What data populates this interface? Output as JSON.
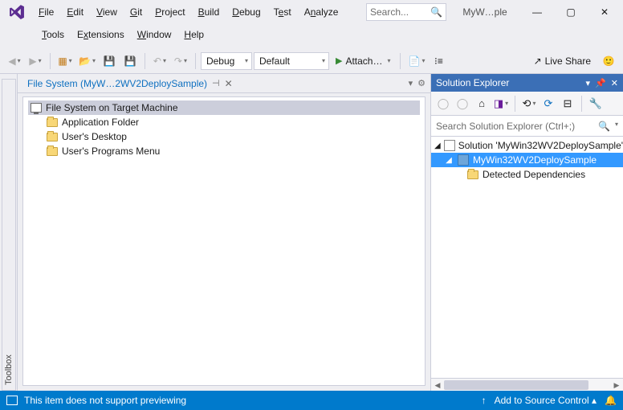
{
  "menu": {
    "file": "File",
    "edit": "Edit",
    "view": "View",
    "git": "Git",
    "project": "Project",
    "build": "Build",
    "debug": "Debug",
    "test": "Test",
    "analyze": "Analyze",
    "tools": "Tools",
    "extensions": "Extensions",
    "window": "Window",
    "help": "Help"
  },
  "search": {
    "placeholder": "Search..."
  },
  "solution_short": "MyW…ple",
  "toolbar": {
    "config": "Debug",
    "platform": "Default",
    "attach": "Attach…",
    "liveshare": "Live Share"
  },
  "sidebar": {
    "toolbox": "Toolbox"
  },
  "doc_tab": {
    "title": "File System (MyW…2WV2DeploySample)"
  },
  "fs_tree": {
    "root": "File System on Target Machine",
    "items": [
      "Application Folder",
      "User's Desktop",
      "User's Programs Menu"
    ]
  },
  "solexp": {
    "title": "Solution Explorer",
    "search_placeholder": "Search Solution Explorer (Ctrl+;)",
    "solution": "Solution 'MyWin32WV2DeploySample'",
    "project": "MyWin32WV2DeploySample",
    "deps": "Detected Dependencies"
  },
  "status": {
    "msg": "This item does not support previewing",
    "source_control": "Add to Source Control"
  }
}
